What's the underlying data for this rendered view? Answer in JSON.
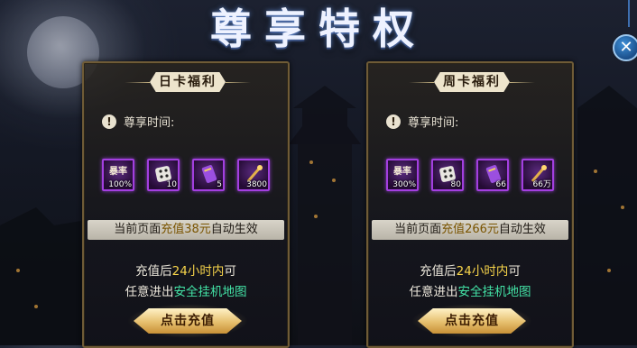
{
  "title": "尊享特权",
  "close": {
    "icon": "close-icon",
    "glyph": "✕"
  },
  "colors": {
    "panel_border": "#6f5b36",
    "item_border": "#a33fe0",
    "highlight_yellow": "#f6d34a",
    "highlight_green": "#43e3a6",
    "close_blue": "#1b4f8a"
  },
  "cards": [
    {
      "name": "日卡福利",
      "time_label": "尊享时间:",
      "items": [
        {
          "icon": "vip-tag-icon",
          "top_text": "暴率",
          "count": "100%"
        },
        {
          "icon": "dice-icon",
          "count": "10"
        },
        {
          "icon": "purple-scroll-icon",
          "count": "5"
        },
        {
          "icon": "gold-staff-icon",
          "count": "3800"
        }
      ],
      "auto_text_pre": "当前页面",
      "auto_text_amount": "充值38元",
      "auto_text_post": "自动生效",
      "desc_line1_pre": "充值后",
      "desc_line1_hl": "24小时内",
      "desc_line1_post": "可",
      "desc_line2_pre": "任意进出",
      "desc_line2_hl": "安全挂机地图",
      "button": "点击充值"
    },
    {
      "name": "周卡福利",
      "time_label": "尊享时间:",
      "items": [
        {
          "icon": "vip-tag-icon",
          "top_text": "暴率",
          "count": "300%"
        },
        {
          "icon": "dice-icon",
          "count": "80"
        },
        {
          "icon": "purple-scroll-icon",
          "count": "66"
        },
        {
          "icon": "gold-staff-icon",
          "count": "66万"
        }
      ],
      "auto_text_pre": "当前页面",
      "auto_text_amount": "充值266元",
      "auto_text_post": "自动生效",
      "desc_line1_pre": "充值后",
      "desc_line1_hl": "24小时内",
      "desc_line1_post": "可",
      "desc_line2_pre": "任意进出",
      "desc_line2_hl": "安全挂机地图",
      "button": "点击充值"
    }
  ]
}
